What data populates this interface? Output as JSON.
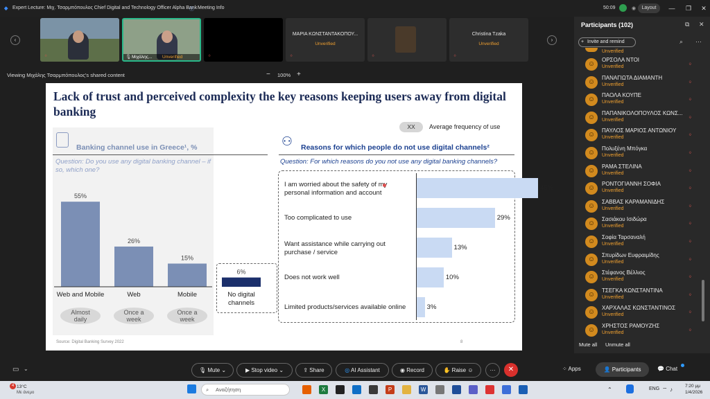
{
  "window": {
    "title": "Expert Lecture: Μιχ. Τσαρμπόπουλος Chief Digital and Technology Officer Alpha Bank",
    "meeting_info": "Meeting Info",
    "time": "50:09",
    "layout_label": "Layout"
  },
  "video_tiles": [
    {
      "name": "",
      "status": ""
    },
    {
      "name": "Μιχάλης...",
      "status": "Unverified"
    },
    {
      "name": "",
      "status": ""
    },
    {
      "name": "ΜΑΡΙΑ ΚΩΝΣΤΑΝΤΑΚΟΠΟΥ...",
      "status": "Unverified"
    },
    {
      "name": "",
      "status": ""
    },
    {
      "name": "Christina Tzaka",
      "status": "Unverified"
    }
  ],
  "share_bar": {
    "viewing": "Viewing Μιχάλης Τσαρμπόπουλος's shared content",
    "zoom": "100%",
    "minus": "−",
    "plus": "+"
  },
  "slide": {
    "title": "Lack of trust and perceived complexity the key reasons keeping users away from digital banking",
    "legend_badge": "XX",
    "legend_text": "Average frequency of use",
    "left_heading": "Banking channel use in Greece¹, %",
    "left_question": "Question: Do you use any digital banking channel – if so, which one?",
    "right_heading": "Reasons for which people do not use digital channels²",
    "right_question": "Question: For which reasons do you not use any digital banking channels?",
    "source": "Source: Digital Banking Survey 2022",
    "page": "8"
  },
  "chart_data": [
    {
      "type": "bar",
      "title": "Banking channel use in Greece¹, %",
      "categories": [
        "Web and Mobile",
        "Web",
        "Mobile",
        "No digital channels"
      ],
      "values": [
        55,
        26,
        15,
        6
      ],
      "value_labels": [
        "55%",
        "26%",
        "15%",
        "6%"
      ],
      "frequency": [
        "Almost daily",
        "Once a week",
        "Once a week"
      ],
      "ylim": [
        0,
        60
      ]
    },
    {
      "type": "bar",
      "orientation": "horizontal",
      "title": "Reasons for which people do not use digital channels²",
      "categories": [
        "I am worried about the safety of my personal information and account",
        "Too complicated to use",
        "Want assistance while carrying out purchase / service",
        "Does not work well",
        "Limited products/services available online"
      ],
      "values": [
        45,
        29,
        13,
        10,
        3
      ],
      "value_labels": [
        "45%",
        "29%",
        "13%",
        "10%",
        "3%"
      ],
      "xlim": [
        0,
        45
      ]
    }
  ],
  "participants": {
    "title": "Participants (102)",
    "invite": "Invite and remind",
    "mute_all": "Mute all",
    "unmute_all": "Unmute all",
    "status": "Unverified",
    "list": [
      "ΟΡΣΟΛΑ ΝΤΟΙ",
      "ΠΑΝΑΓΙΩΤΑ ΔΙΑΜΑΝΤΗ",
      "ΠΑΟΛΑ ΚΟΥΠΕ",
      "ΠΑΠΑΝΙΚΟΛΟΠΟΥΛΟΣ ΚΩΝΣ...",
      "ΠΑΥΛΟΣ ΜΑΡΙΟΣ ΑΝΤΩΝΙΟΥ",
      "Πολυξένη Μπόγκα",
      "ΡΑΜΑ ΣΤΕΛΙΝΑ",
      "ΡΟΝΤΟΓΙΑΝΝΗ ΣΟΦΙΑ",
      "ΣΑΒΒΑΣ ΚΑΡΑΜΑΝΙΔΗΣ",
      "Σασιάκου Ισιδώρα",
      "Σοφία Ταρσαναλή",
      "Σπυρίδων Ευφραιμίδης",
      "Στέφανος Βέλλιος",
      "ΤΣΕΓΚΑ ΚΩΝΣΤΑΝΤΙΝΑ",
      "ΧΑΡΧΑΛΑΣ ΚΩΝΣΤΑΝΤΙΝΟΣ",
      "ΧΡΗΣΤΟΣ ΡΑΜΟΥΖΗΣ"
    ]
  },
  "toolbar": {
    "mute": "Mute",
    "stop_video": "Stop video",
    "share": "Share",
    "ai_assistant": "AI Assistant",
    "record": "Record",
    "raise": "Raise",
    "more": "···",
    "apps": "Apps",
    "participants": "Participants",
    "chat": "Chat"
  },
  "taskbar": {
    "temperature": "13°C",
    "weather": "Με άνεμο",
    "search": "Αναζήτηση",
    "lang": "ENG",
    "time": "7:20 μμ",
    "date": "1/4/2026",
    "notification_count": "4"
  }
}
